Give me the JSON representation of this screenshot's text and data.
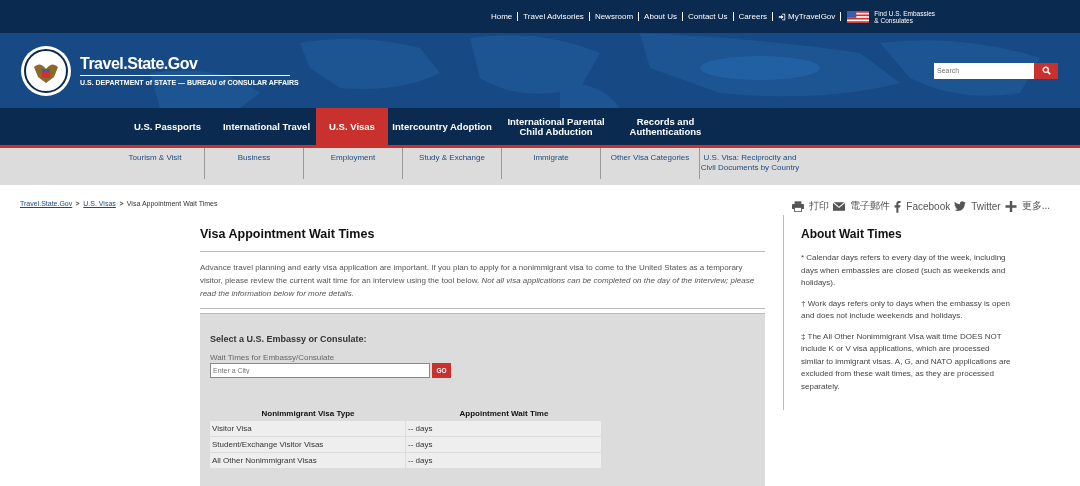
{
  "top_links": [
    {
      "label": "Home",
      "kind": "text"
    },
    {
      "label": "Travel Advisories",
      "kind": "text"
    },
    {
      "label": "Newsroom",
      "kind": "text"
    },
    {
      "label": "About Us",
      "kind": "text"
    },
    {
      "label": "Contact Us",
      "kind": "text"
    },
    {
      "label": "Careers",
      "kind": "text"
    },
    {
      "label": "MyTravelGov",
      "kind": "login"
    }
  ],
  "embassies_link": {
    "line1": "Find U.S. Embassies",
    "line2": "& Consulates"
  },
  "site": {
    "title": "Travel.State.Gov",
    "subtitle": "U.S. DEPARTMENT of STATE — BUREAU of CONSULAR AFFAIRS"
  },
  "search": {
    "placeholder": "Search"
  },
  "nav": [
    {
      "label": "U.S. Passports",
      "selected": false
    },
    {
      "label": "International Travel",
      "selected": false
    },
    {
      "label": "U.S. Visas",
      "selected": true
    },
    {
      "label": "Intercountry Adoption",
      "selected": false
    },
    {
      "label": "International Parental Child Abduction",
      "selected": false
    },
    {
      "label": "Records and Authentications",
      "selected": false
    }
  ],
  "subnav": [
    "Tourism & Visit",
    "Business",
    "Employment",
    "Study & Exchange",
    "Immigrate",
    "Other Visa Categories",
    "U.S. Visa: Reciprocity and Civil Documents by Country"
  ],
  "breadcrumb": {
    "links": [
      "Travel.State.Gov",
      "U.S. Visas"
    ],
    "current": "Visa Appointment Wait Times"
  },
  "share": [
    {
      "kind": "print",
      "label": "打印"
    },
    {
      "kind": "email",
      "label": "電子郵件"
    },
    {
      "kind": "facebook",
      "label": "Facebook"
    },
    {
      "kind": "twitter",
      "label": "Twitter"
    },
    {
      "kind": "more",
      "label": "更多..."
    }
  ],
  "page_title": "Visa Appointment Wait Times",
  "intro": "Advance travel planning and early visa application are important. If you plan to apply for a nonimmigrant visa to come to the United States as a temporary visitor, please review the current wait time for an interview using the tool below. *Not all visa applications can be completed on the day of the interview; please read the information below for more details.*",
  "tool": {
    "heading": "Select a U.S. Embassy or Consulate:",
    "field_label": "Wait Times for Embassy/Consulate",
    "placeholder": "Enter a City",
    "button": "GO",
    "columns": [
      "Nonimmigrant Visa Type",
      "Appointment Wait Time"
    ],
    "rows": [
      [
        "Visitor Visa",
        "-- days"
      ],
      [
        "Student/Exchange Visitor Visas",
        "-- days"
      ],
      [
        "All Other Nonimmigrant Visas",
        "-- days"
      ]
    ]
  },
  "sidebar": {
    "title": "About Wait Times",
    "notes": [
      "* Calendar days refers to every day of the week, including days when embassies are closed (such as weekends and holidays).",
      "† Work days refers only to days when the embassy is open and does not include weekends and holidays.",
      "‡ The All Other Nonimmigrant Visa wait time DOES NOT include K or V visa applications, which are processed similar to immigrant visas.  A, G, and NATO applications are excluded from these wait times, as they are processed separately."
    ]
  }
}
